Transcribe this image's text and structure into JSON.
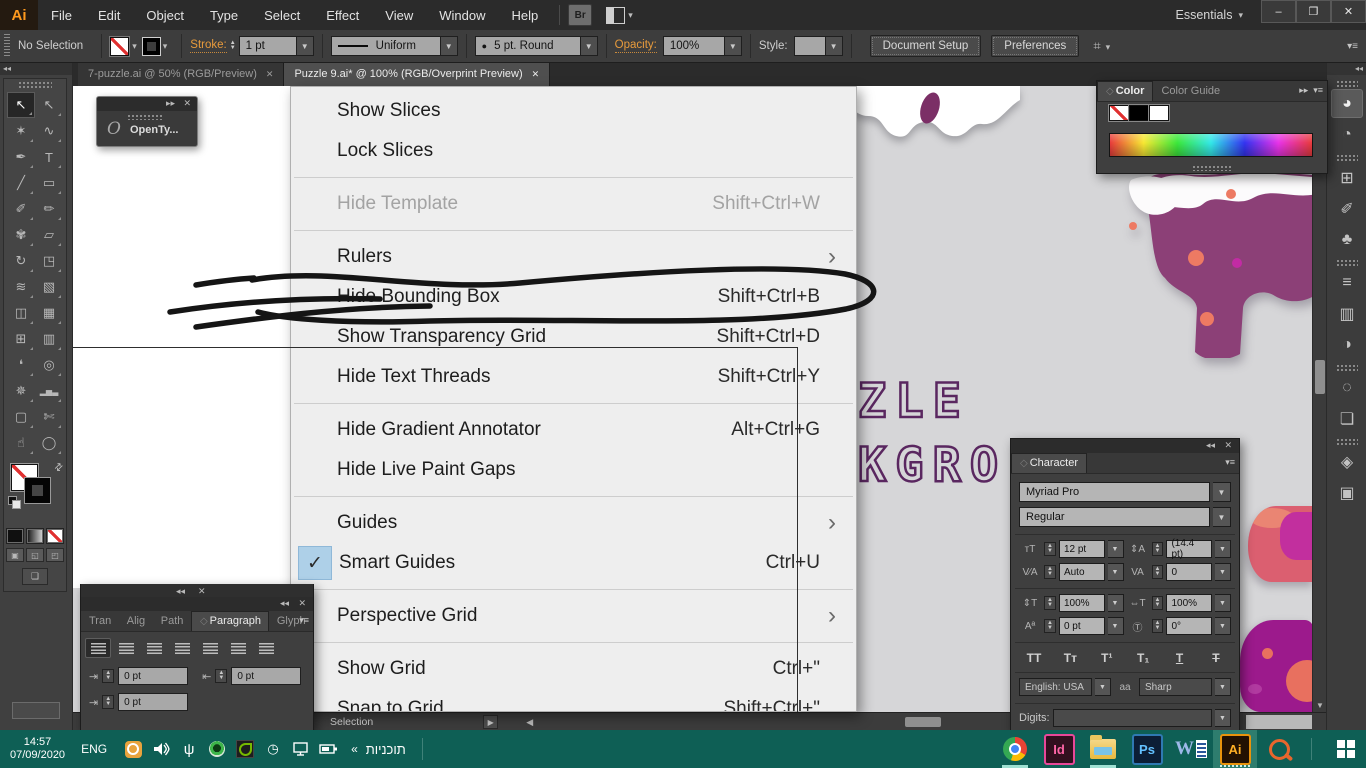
{
  "window": {
    "workspace": "Essentials",
    "minimize": "–",
    "restore": "❐",
    "close": "✕"
  },
  "menubar": {
    "logo": "Ai",
    "items": [
      "File",
      "Edit",
      "Object",
      "Type",
      "Select",
      "Effect",
      "View",
      "Window",
      "Help"
    ],
    "bridge": "Br"
  },
  "control_bar": {
    "selection_status": "No Selection",
    "stroke_label": "Stroke:",
    "stroke_weight": "1 pt",
    "profile": "Uniform",
    "brush": "5 pt. Round",
    "opacity_label": "Opacity:",
    "opacity_value": "100%",
    "style_label": "Style:",
    "document_setup": "Document Setup",
    "preferences": "Preferences"
  },
  "tabs": [
    {
      "title": "7-puzzle.ai @ 50% (RGB/Preview)",
      "close": "✕"
    },
    {
      "title": "Puzzle 9.ai* @ 100% (RGB/Overprint Preview)",
      "close": "✕"
    }
  ],
  "view_menu": {
    "items": [
      {
        "label": "Show Slices"
      },
      {
        "label": "Lock Slices"
      },
      {
        "type": "separator"
      },
      {
        "label": "Hide Template",
        "shortcut": "Shift+Ctrl+W",
        "disabled": true
      },
      {
        "type": "separator"
      },
      {
        "label": "Rulers",
        "submenu": true
      },
      {
        "label": "Hide Bounding Box",
        "shortcut": "Shift+Ctrl+B"
      },
      {
        "label": "Show Transparency Grid",
        "shortcut": "Shift+Ctrl+D"
      },
      {
        "label": "Hide Text Threads",
        "shortcut": "Shift+Ctrl+Y"
      },
      {
        "type": "separator"
      },
      {
        "label": "Hide Gradient Annotator",
        "shortcut": "Alt+Ctrl+G"
      },
      {
        "label": "Hide Live Paint Gaps"
      },
      {
        "type": "separator"
      },
      {
        "label": "Guides",
        "submenu": true
      },
      {
        "label": "Smart Guides",
        "shortcut": "Ctrl+U",
        "checked": true
      },
      {
        "type": "separator"
      },
      {
        "label": "Perspective Grid",
        "submenu": true
      },
      {
        "type": "separator"
      },
      {
        "label": "Show Grid",
        "shortcut": "Ctrl+\""
      },
      {
        "label": "Snap to Grid",
        "shortcut": "Shift+Ctrl+\""
      }
    ]
  },
  "tools": [
    {
      "name": "selection",
      "glyph": "↖",
      "active": true
    },
    {
      "name": "direct-selection",
      "glyph": "↖"
    },
    {
      "name": "magic-wand",
      "glyph": "✶"
    },
    {
      "name": "lasso",
      "glyph": "∿"
    },
    {
      "name": "pen",
      "glyph": "✒"
    },
    {
      "name": "type",
      "glyph": "T"
    },
    {
      "name": "line-segment",
      "glyph": "╱"
    },
    {
      "name": "rectangle",
      "glyph": "▭"
    },
    {
      "name": "paintbrush",
      "glyph": "✐"
    },
    {
      "name": "pencil",
      "glyph": "✏"
    },
    {
      "name": "blob-brush",
      "glyph": "✾"
    },
    {
      "name": "eraser",
      "glyph": "▱"
    },
    {
      "name": "rotate",
      "glyph": "↻"
    },
    {
      "name": "scale",
      "glyph": "◳"
    },
    {
      "name": "width",
      "glyph": "≋"
    },
    {
      "name": "free-transform",
      "glyph": "▧"
    },
    {
      "name": "shape-builder",
      "glyph": "◫"
    },
    {
      "name": "perspective-grid",
      "glyph": "▦"
    },
    {
      "name": "mesh",
      "glyph": "⊞"
    },
    {
      "name": "gradient",
      "glyph": "▥"
    },
    {
      "name": "eyedropper",
      "glyph": "❛"
    },
    {
      "name": "blend",
      "glyph": "◎"
    },
    {
      "name": "symbol-sprayer",
      "glyph": "✵"
    },
    {
      "name": "column-graph",
      "glyph": "▂▅▃"
    },
    {
      "name": "artboard",
      "glyph": "▢"
    },
    {
      "name": "slice",
      "glyph": "✄"
    },
    {
      "name": "hand",
      "glyph": "☝"
    },
    {
      "name": "zoom",
      "glyph": "◯"
    }
  ],
  "dock": [
    {
      "type": "grip"
    },
    {
      "name": "color",
      "glyph": "◕",
      "active": true
    },
    {
      "name": "color-guide",
      "glyph": "◔"
    },
    {
      "type": "grip"
    },
    {
      "name": "swatches",
      "glyph": "⊞"
    },
    {
      "name": "brushes",
      "glyph": "✐"
    },
    {
      "name": "symbols",
      "glyph": "♣"
    },
    {
      "type": "grip"
    },
    {
      "name": "stroke",
      "glyph": "≡"
    },
    {
      "name": "gradient",
      "glyph": "▥"
    },
    {
      "name": "transparency",
      "glyph": "◑"
    },
    {
      "type": "grip"
    },
    {
      "name": "appearance",
      "glyph": "◌"
    },
    {
      "name": "graphic-styles",
      "glyph": "❏"
    },
    {
      "type": "grip"
    },
    {
      "name": "layers",
      "glyph": "◈"
    },
    {
      "name": "artboards",
      "glyph": "▣"
    }
  ],
  "panels": {
    "opentype": {
      "label": "OpenTy...",
      "glyph": "O"
    },
    "color": {
      "tab_color": "Color",
      "tab_color_guide": "Color Guide"
    },
    "paragraph": {
      "tabs": [
        "Tran",
        "Alig",
        "Path",
        "Paragraph",
        "Glyph"
      ],
      "left_indent": "0 pt",
      "right_indent": "0 pt",
      "first_line_indent": "0 pt"
    },
    "character": {
      "title": "Character",
      "font_family": "Myriad Pro",
      "font_style": "Regular",
      "font_size": "12 pt",
      "leading": "(14.4 pt)",
      "kerning": "Auto",
      "tracking": "0",
      "v_scale": "100%",
      "h_scale": "100%",
      "baseline_shift": "0 pt",
      "rotation": "0°",
      "caps": "TT",
      "small_caps": "Tᴛ",
      "superscript": "T¹",
      "subscript": "T₁",
      "underline": "T",
      "strikethrough": "T",
      "language": "English: USA",
      "anti_alias": "Sharp",
      "digits_label": "Digits:"
    }
  },
  "icons": {
    "size": "тT",
    "leading": "⇕A",
    "kerning": "V∕A",
    "tracking": "VA",
    "v_scale": "⇕T",
    "h_scale": "⇔T",
    "baseline": "Aª",
    "rotation": "Ⓣ",
    "anti_alias": "aa",
    "left_indent": "⇥",
    "right_indent": "⇤",
    "first_line_indent": "⇥"
  },
  "canvas": {
    "art_text_line1": "ZLE",
    "art_text_line2": "KGRO"
  },
  "status_bar": {
    "selection_label": "Selection"
  },
  "taskbar": {
    "time": "14:57",
    "date": "07/09/2020",
    "language": "ENG",
    "programs_label": "תוכניות",
    "indesign": "Id",
    "word": "W",
    "photoshop": "Ps",
    "illustrator": "Ai"
  },
  "colors": {
    "accent_orange": "#e89b3c",
    "taskbar_green": "#0e5f55",
    "canvas_gray": "#d6d6d8",
    "artwork_purple": "#8c4077",
    "menu_bg": "#eeeeee",
    "check_highlight": "#aed0e8"
  }
}
